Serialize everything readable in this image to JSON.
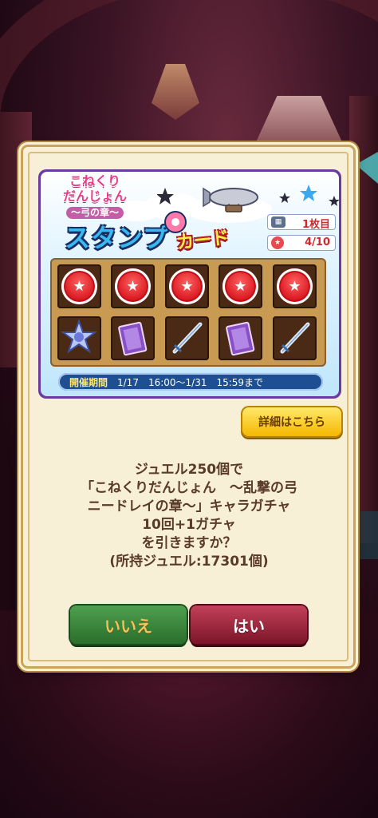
{
  "event_logo": {
    "line1": "こねくり",
    "line1b": "だんじょん",
    "line2": "〜弓の章〜"
  },
  "stamp_card": {
    "title_part1": "スタンプ",
    "title_part2": "カード",
    "sheet_count": "1枚目",
    "stamp_progress": "4/10",
    "stamped_count": 5,
    "rewards": [
      "star-crystal-icon",
      "book-icon",
      "sword-icon",
      "book-icon",
      "sword-icon"
    ],
    "period_label": "開催期間",
    "period_text": "1/17　16:00〜1/31　15:59まで"
  },
  "details_button": "詳細はこちら",
  "message": {
    "line1": "ジュエル250個で",
    "line2": "「こねくりだんじょん　〜乱撃の弓",
    "line3": "ニードレイの章〜」キャラガチャ",
    "line4": "10回+1ガチャ",
    "line5": "を引きますか？",
    "line6": "(所持ジュエル:17301個)"
  },
  "buttons": {
    "no": "いいえ",
    "yes": "はい"
  }
}
